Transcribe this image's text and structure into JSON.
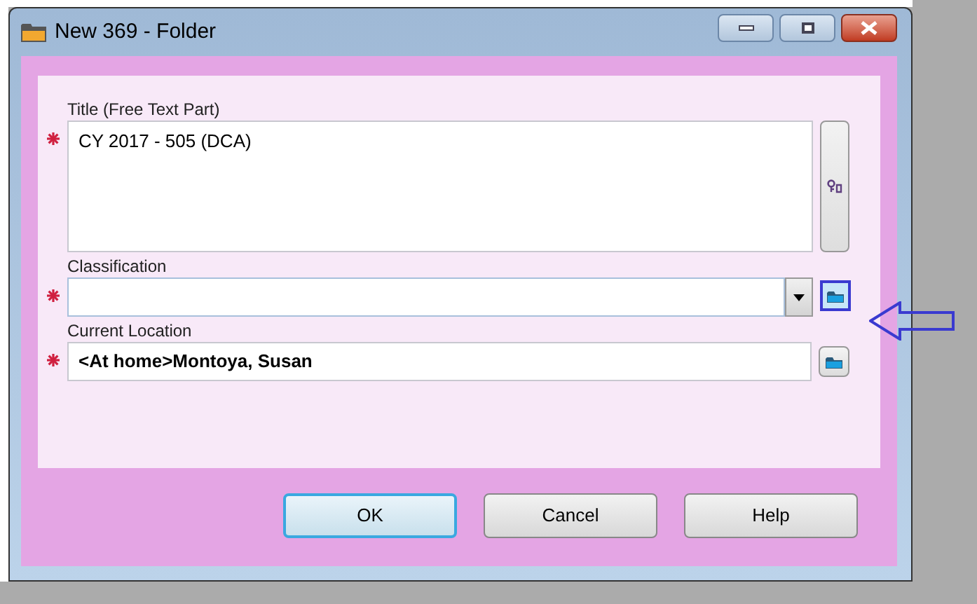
{
  "window": {
    "title": "New 369 - Folder"
  },
  "fields": [
    {
      "kind": "textarea",
      "label": "Title (Free Text Part)",
      "required": true,
      "value": "CY 2017 - 505 (DCA)",
      "bold": false,
      "highlighted": false
    },
    {
      "kind": "combo",
      "label": "Classification",
      "required": true,
      "bold": false,
      "highlighted": true
    },
    {
      "kind": "lookup",
      "label": "Current Location",
      "required": true,
      "value": "<At home>Montoya, Susan",
      "bold": true,
      "highlighted": false
    }
  ],
  "buttons": [
    {
      "label": "OK",
      "default": true
    },
    {
      "label": "Cancel",
      "default": false
    },
    {
      "label": "Help",
      "default": false
    }
  ]
}
